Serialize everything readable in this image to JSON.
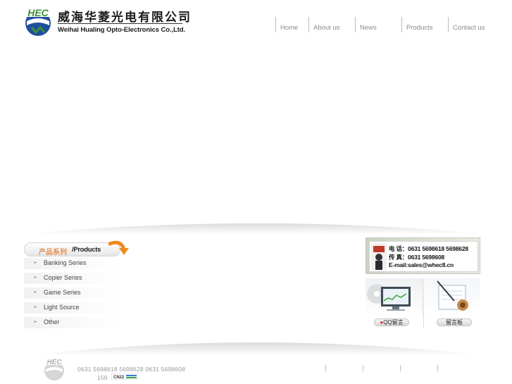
{
  "header": {
    "logo_text": "HEC",
    "company_cn": "威海华菱光电有限公司",
    "company_en": "Weihai Hualing Opto-Electronics Co.,Ltd."
  },
  "nav": [
    {
      "label": "Home"
    },
    {
      "label": "About us"
    },
    {
      "label": "News"
    },
    {
      "label": "Products"
    },
    {
      "label": "Contact us"
    }
  ],
  "products": {
    "title_cn": "产品系列",
    "title_en": "/Products",
    "items": [
      {
        "label": "Banking Series"
      },
      {
        "label": "Copier Series"
      },
      {
        "label": "Game Series"
      },
      {
        "label": "Light Source"
      },
      {
        "label": "Other"
      }
    ]
  },
  "contact": {
    "phone_line": "电  话：0631 5698618 5698628",
    "fax_line": "传  真：0631 5698608",
    "email_line": "E-mail:sales@whec8.cn"
  },
  "qq": {
    "label": "QQ留言"
  },
  "board": {
    "label": "留言板"
  },
  "footer": {
    "phone_line": "0631 5698618 5698628    0631 5698608",
    "phone_line2": "159",
    "badge_text": "CN22"
  },
  "colors": {
    "logo_green": "#3d8f3a",
    "logo_blue": "#1f4f9c",
    "products_accent": "#e0600a"
  }
}
